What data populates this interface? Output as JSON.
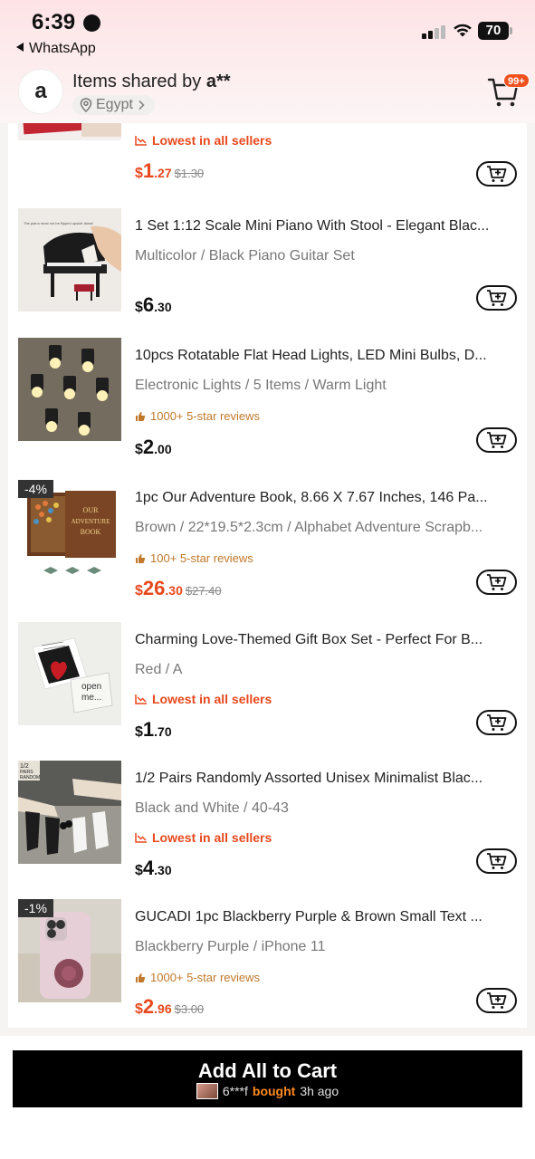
{
  "status_bar": {
    "time": "6:39",
    "back_app": "WhatsApp",
    "battery": "70"
  },
  "header": {
    "avatar_letter": "a",
    "title_prefix": "Items shared by ",
    "title_user": "a**",
    "location": "Egypt",
    "cart_badge": "99+"
  },
  "items": [
    {
      "title": "",
      "variant": "",
      "badge_type": "lowest",
      "badge": "Lowest in all sellers",
      "price_currency": "$",
      "price_int": "1",
      "price_dec": ".27",
      "price_original": "$1.30",
      "sale": true,
      "discount": ""
    },
    {
      "title": "1 Set 1:12 Scale Mini Piano With Stool - Elegant Blac...",
      "variant": "Multicolor / Black Piano Guitar Set",
      "badge_type": "",
      "badge": "",
      "price_currency": "$",
      "price_int": "6",
      "price_dec": ".30",
      "price_original": "",
      "sale": false,
      "discount": ""
    },
    {
      "title": "10pcs Rotatable Flat Head Lights, LED Mini Bulbs, D...",
      "variant": "Electronic Lights / 5 Items / Warm Light",
      "badge_type": "review",
      "badge": "1000+ 5-star reviews",
      "price_currency": "$",
      "price_int": "2",
      "price_dec": ".00",
      "price_original": "",
      "sale": false,
      "discount": ""
    },
    {
      "title": "1pc Our Adventure Book, 8.66 X 7.67 Inches, 146 Pa...",
      "variant": "Brown / 22*19.5*2.3cm / Alphabet Adventure Scrapb...",
      "badge_type": "review",
      "badge": "100+ 5-star reviews",
      "price_currency": "$",
      "price_int": "26",
      "price_dec": ".30",
      "price_original": "$27.40",
      "sale": true,
      "discount": "-4%"
    },
    {
      "title": "Charming Love-Themed Gift Box Set - Perfect For B...",
      "variant": "Red / A",
      "badge_type": "lowest",
      "badge": "Lowest in all sellers",
      "price_currency": "$",
      "price_int": "1",
      "price_dec": ".70",
      "price_original": "",
      "sale": false,
      "discount": ""
    },
    {
      "title": "1/2 Pairs Randomly Assorted Unisex Minimalist Blac...",
      "variant": "Black and White / 40-43",
      "badge_type": "lowest",
      "badge": "Lowest in all sellers",
      "price_currency": "$",
      "price_int": "4",
      "price_dec": ".30",
      "price_original": "",
      "sale": false,
      "discount": ""
    },
    {
      "title": "GUCADI 1pc Blackberry Purple & Brown Small Text ...",
      "variant": "Blackberry Purple / iPhone 11",
      "badge_type": "review",
      "badge": "1000+ 5-star reviews",
      "price_currency": "$",
      "price_int": "2",
      "price_dec": ".96",
      "price_original": "$3.00",
      "sale": true,
      "discount": "-1%"
    }
  ],
  "thumb_text": {
    "piano_note": "The piano must not be flipped upside down!",
    "book_line1": "OUR",
    "book_line2": "ADVENTURE",
    "book_line3": "BOOK",
    "gift_card_line1": "open",
    "gift_card_line2": "me...",
    "socks_tag_line1": "1/2",
    "socks_tag_line2": "PAIRS",
    "socks_tag_line3": "RANDOM"
  },
  "footer": {
    "cta_label": "Add All to Cart",
    "buyer": "6***f",
    "bought": "bought",
    "time_ago": "3h ago"
  },
  "colors": {
    "sale_price": "#e8481c",
    "badge_orange": "#f2501e",
    "review_text": "#c0782a",
    "cta_bg": "#000000"
  }
}
